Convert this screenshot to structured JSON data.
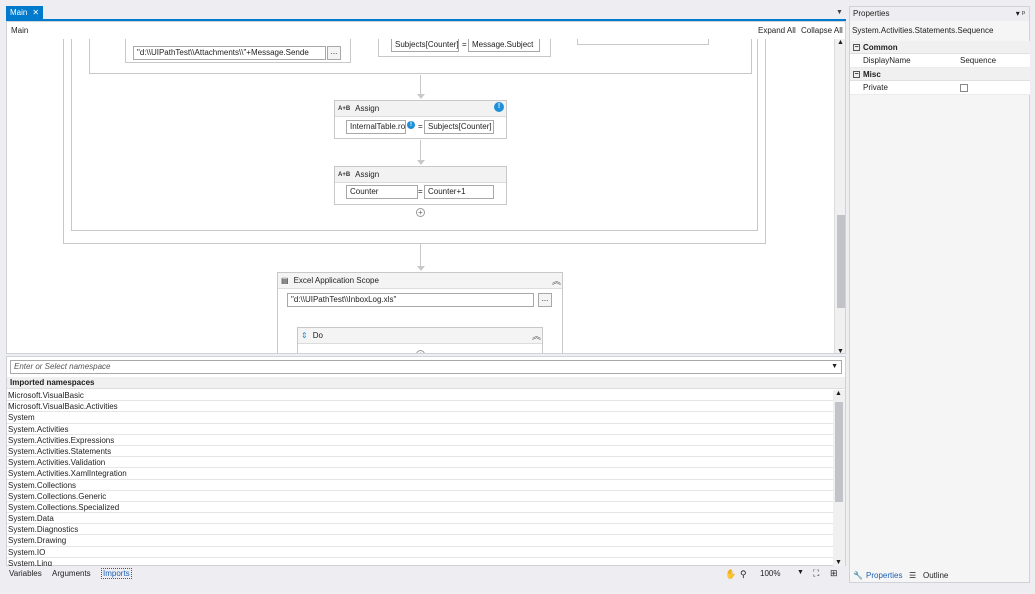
{
  "tab": {
    "label": "Main",
    "close": "✕"
  },
  "designer": {
    "breadcrumb": "Main",
    "expand_all": "Expand All",
    "collapse_all": "Collapse All",
    "top_field_1": "\"d:\\\\UIPathTest\\\\Attachments\\\\\"+Message.Sende",
    "top_button": "...",
    "top_field_left": "Subjects[Counter]",
    "top_field_right": "Message.Subject",
    "eq": "=",
    "assign1": {
      "title": "Assign",
      "icon": "A+B",
      "left": "InternalTable.ro",
      "right": "Subjects[Counter]"
    },
    "assign2": {
      "title": "Assign",
      "icon": "A+B",
      "left": "Counter",
      "right": "Counter+1"
    },
    "excel": {
      "title": "Excel Application Scope",
      "path": "\"d:\\\\UIPathTest\\\\InboxLog.xls\"",
      "button": "..."
    },
    "do": {
      "title": "Do"
    }
  },
  "imports": {
    "placeholder": "Enter or Select namespace",
    "header": "Imported namespaces",
    "namespaces": [
      "Microsoft.VisualBasic",
      "Microsoft.VisualBasic.Activities",
      "System",
      "System.Activities",
      "System.Activities.Expressions",
      "System.Activities.Statements",
      "System.Activities.Validation",
      "System.Activities.XamlIntegration",
      "System.Collections",
      "System.Collections.Generic",
      "System.Collections.Specialized",
      "System.Data",
      "System.Diagnostics",
      "System.Drawing",
      "System.IO",
      "System.Linq"
    ]
  },
  "bottom": {
    "variables": "Variables",
    "arguments": "Arguments",
    "imports": "Imports",
    "zoom": "100%"
  },
  "properties": {
    "title": "Properties",
    "pin": "▾ ᵖ",
    "type": "System.Activities.Statements.Sequence",
    "cat_common": "Common",
    "cat_misc": "Misc",
    "displayname_label": "DisplayName",
    "displayname_value": "Sequence",
    "private_label": "Private",
    "tab_properties": "Properties",
    "tab_outline": "Outline"
  },
  "colors": {
    "accent": "#007acc",
    "info": "#1e90d8"
  }
}
